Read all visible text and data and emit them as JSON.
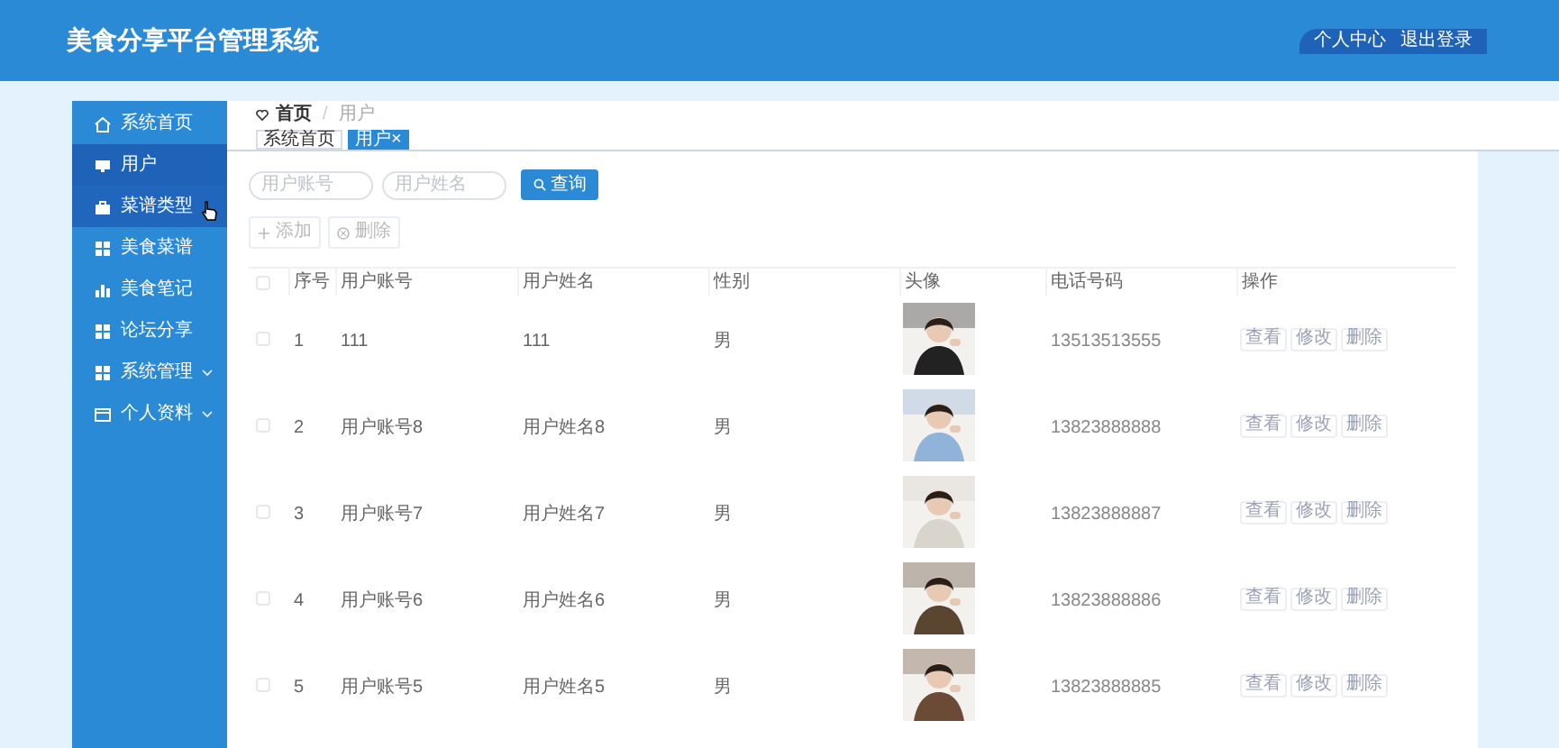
{
  "header": {
    "title": "美食分享平台管理系统",
    "links": [
      "个人中心",
      "退出登录"
    ]
  },
  "sidebar": {
    "items": [
      {
        "label": "系统首页",
        "kind": "home",
        "selected": false,
        "hovered": false,
        "expandable": false
      },
      {
        "label": "用户",
        "kind": "monitor",
        "selected": true,
        "hovered": false,
        "expandable": false
      },
      {
        "label": "菜谱类型",
        "kind": "bag",
        "selected": false,
        "hovered": true,
        "expandable": false
      },
      {
        "label": "美食菜谱",
        "kind": "grid",
        "selected": false,
        "hovered": false,
        "expandable": false
      },
      {
        "label": "美食笔记",
        "kind": "chart",
        "selected": false,
        "hovered": false,
        "expandable": false
      },
      {
        "label": "论坛分享",
        "kind": "grid",
        "selected": false,
        "hovered": false,
        "expandable": false
      },
      {
        "label": "系统管理",
        "kind": "grid",
        "selected": false,
        "hovered": false,
        "expandable": true
      },
      {
        "label": "个人资料",
        "kind": "card",
        "selected": false,
        "hovered": false,
        "expandable": true
      }
    ]
  },
  "breadcrumb": {
    "home": "首页",
    "separator": "/",
    "current": "用户"
  },
  "tabs": [
    {
      "label": "系统首页",
      "selected": false
    },
    {
      "label": "用户",
      "close": "×",
      "selected": true
    }
  ],
  "search": {
    "fields": [
      {
        "placeholder": "用户账号"
      },
      {
        "placeholder": "用户姓名"
      }
    ],
    "button": "查询"
  },
  "actions": [
    "添加",
    "删除"
  ],
  "table": {
    "header_checked": false,
    "columns": [
      "序号",
      "用户账号",
      "用户姓名",
      "性别",
      "头像",
      "电话号码",
      "操作"
    ],
    "rows": [
      {
        "checked": false,
        "index": "1",
        "account": "111",
        "name": "111",
        "gender": "男",
        "phone": "13513513555",
        "buttons": [
          "查看",
          "修改",
          "删除"
        ]
      },
      {
        "checked": false,
        "index": "2",
        "account": "用户账号8",
        "name": "用户姓名8",
        "gender": "男",
        "phone": "13823888888",
        "buttons": [
          "查看",
          "修改",
          "删除"
        ]
      },
      {
        "checked": false,
        "index": "3",
        "account": "用户账号7",
        "name": "用户姓名7",
        "gender": "男",
        "phone": "13823888887",
        "buttons": [
          "查看",
          "修改",
          "删除"
        ]
      },
      {
        "checked": false,
        "index": "4",
        "account": "用户账号6",
        "name": "用户姓名6",
        "gender": "男",
        "phone": "13823888886",
        "buttons": [
          "查看",
          "修改",
          "删除"
        ]
      },
      {
        "checked": false,
        "index": "5",
        "account": "用户账号5",
        "name": "用户姓名5",
        "gender": "男",
        "phone": "13823888885",
        "buttons": [
          "查看",
          "修改",
          "删除"
        ]
      }
    ]
  }
}
